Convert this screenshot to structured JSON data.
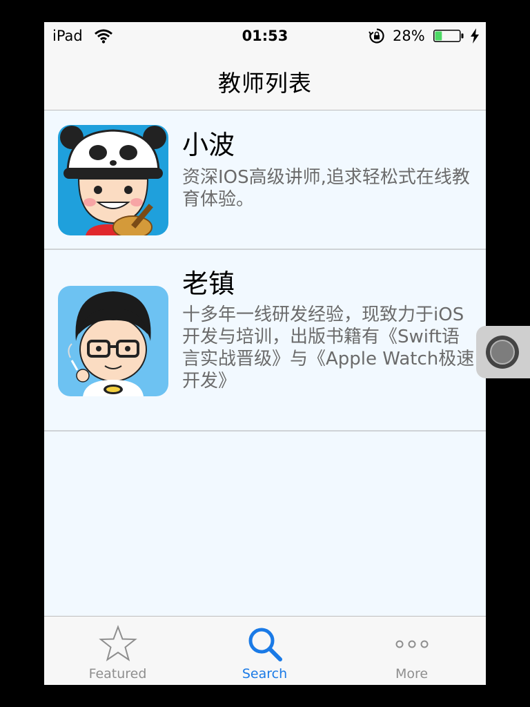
{
  "status_bar": {
    "carrier": "iPad",
    "time": "01:53",
    "battery_percent": "28%",
    "battery_level": 0.28
  },
  "nav_bar": {
    "title": "教师列表"
  },
  "teachers": [
    {
      "name": "小波",
      "description": "资深IOS高级讲师,追求轻松式在线教育体验。"
    },
    {
      "name": "老镇",
      "description": "十多年一线研发经验，现致力于iOS开发与培训，出版书籍有《Swift语言实战晋级》与《Apple Watch极速开发》"
    }
  ],
  "tab_bar": {
    "tabs": [
      {
        "label": "Featured",
        "icon": "star-icon"
      },
      {
        "label": "Search",
        "icon": "search-icon",
        "active": true
      },
      {
        "label": "More",
        "icon": "more-icon"
      }
    ]
  },
  "colors": {
    "accent": "#1a7ae6",
    "battery_fill": "#4cd964",
    "row_background": "#f2f9ff"
  }
}
